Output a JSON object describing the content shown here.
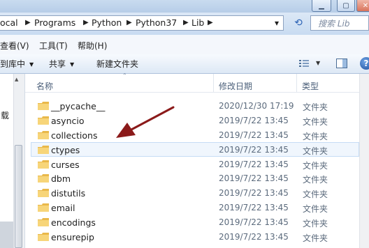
{
  "address": {
    "crumbs": [
      "ocal",
      "Programs",
      "Python",
      "Python37",
      "Lib"
    ],
    "separator": "▶",
    "dropdown": "▾"
  },
  "search": {
    "placeholder": "搜索 Lib"
  },
  "menu": [
    "查看(V)",
    "工具(T)",
    "帮助(H)"
  ],
  "toolbar": {
    "include_library": "到库中",
    "share": "共享",
    "new_folder": "新建文件夹"
  },
  "nav": {
    "fragment": "载"
  },
  "columns": {
    "name": "名称",
    "modified": "修改日期",
    "type": "类型"
  },
  "files": [
    {
      "name": "__pycache__",
      "modified": "2020/12/30 17:19",
      "type": "文件夹"
    },
    {
      "name": "asyncio",
      "modified": "2019/7/22 13:45",
      "type": "文件夹"
    },
    {
      "name": "collections",
      "modified": "2019/7/22 13:45",
      "type": "文件夹"
    },
    {
      "name": "ctypes",
      "modified": "2019/7/22 13:45",
      "type": "文件夹"
    },
    {
      "name": "curses",
      "modified": "2019/7/22 13:45",
      "type": "文件夹"
    },
    {
      "name": "dbm",
      "modified": "2019/7/22 13:45",
      "type": "文件夹"
    },
    {
      "name": "distutils",
      "modified": "2019/7/22 13:45",
      "type": "文件夹"
    },
    {
      "name": "email",
      "modified": "2019/7/22 13:45",
      "type": "文件夹"
    },
    {
      "name": "encodings",
      "modified": "2019/7/22 13:45",
      "type": "文件夹"
    },
    {
      "name": "ensurepip",
      "modified": "2019/7/22 13:45",
      "type": "文件夹"
    }
  ],
  "selected_file": "ctypes",
  "icons": [
    "folder-icon",
    "refresh-icon",
    "view-options-icon",
    "preview-pane-icon",
    "help-icon",
    "minimize-icon",
    "maximize-icon",
    "annotation-arrow"
  ],
  "colors": {
    "folder": "#e9b84a",
    "arrow": "#8b1a1a",
    "selection": "#f0f6fd",
    "chrome": "#c8dbf1"
  }
}
